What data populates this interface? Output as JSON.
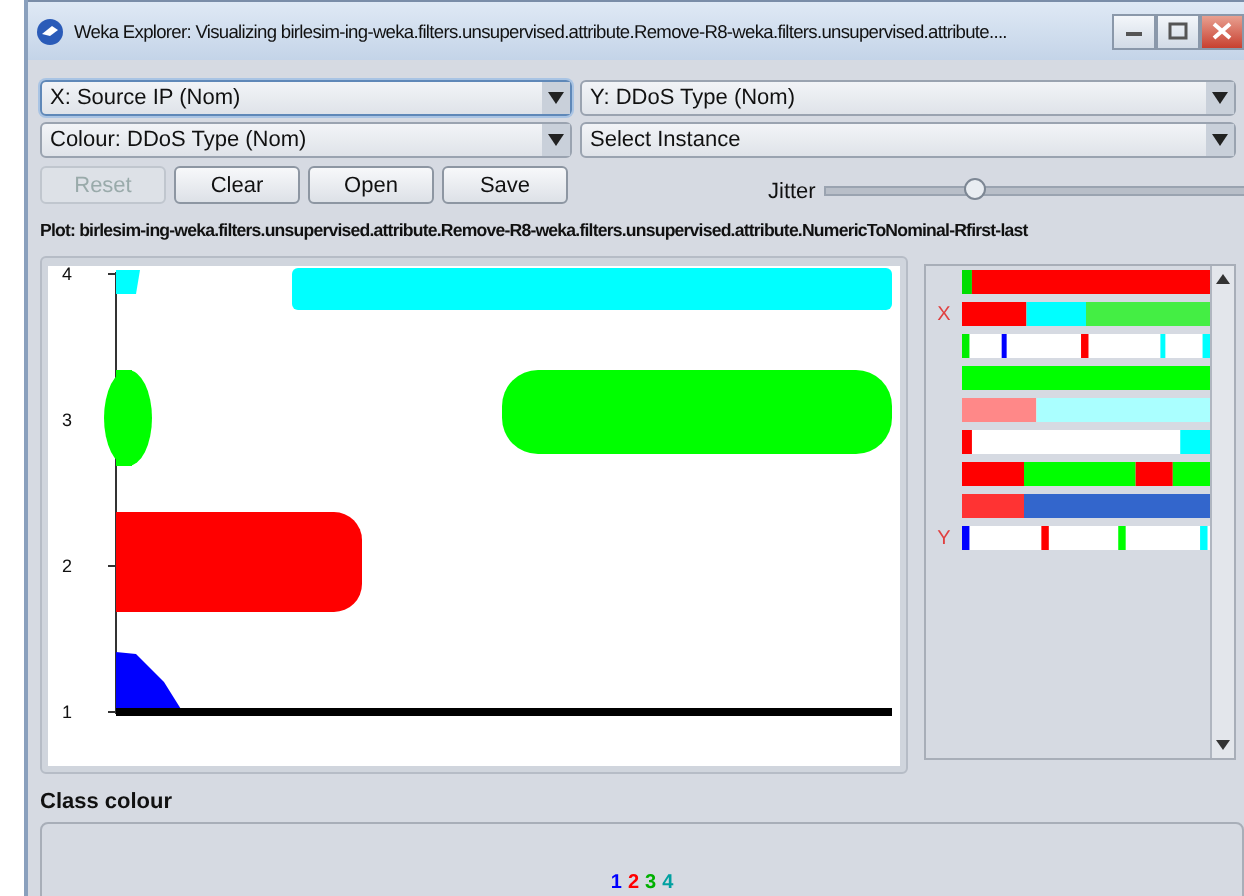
{
  "window": {
    "title": "Weka Explorer: Visualizing birlesim-ing-weka.filters.unsupervised.attribute.Remove-R8-weka.filters.unsupervised.attribute...."
  },
  "selectors": [
    {
      "value": "X: Source IP (Nom)",
      "focused": true
    },
    {
      "value": "Y: DDoS Type (Nom)",
      "focused": false
    },
    {
      "value": "Colour: DDoS Type (Nom)",
      "focused": false
    },
    {
      "value": "Select Instance",
      "focused": false
    }
  ],
  "buttons": [
    {
      "label": "Reset",
      "disabled": true
    },
    {
      "label": "Clear",
      "disabled": false
    },
    {
      "label": "Open",
      "disabled": false
    },
    {
      "label": "Save",
      "disabled": false
    }
  ],
  "jitter": {
    "label": "Jitter",
    "level": 0.36
  },
  "plot": {
    "title": "Plot: birlesim-ing-weka.filters.unsupervised.attribute.Remove-R8-weka.filters.unsupervised.attribute.NumericToNominal-Rfirst-last",
    "y_ticks": [
      "4",
      "3",
      "2",
      "1"
    ]
  },
  "attribute_panel": {
    "x_marker": "X",
    "y_marker": "Y"
  },
  "class_colour": {
    "title": "Class colour",
    "classes": [
      {
        "label": "1",
        "color": "#0000ff"
      },
      {
        "label": "2",
        "color": "#ff0000"
      },
      {
        "label": "3",
        "color": "#00b000"
      },
      {
        "label": "4",
        "color": "#00a0a0"
      }
    ]
  }
}
